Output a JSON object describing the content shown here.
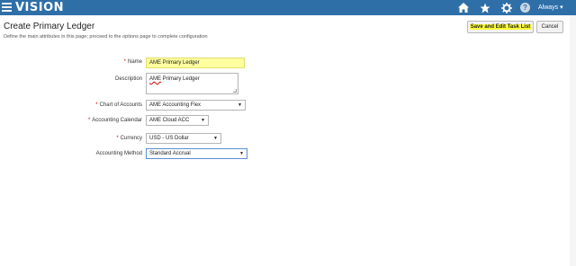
{
  "header": {
    "brand": "VISION",
    "icons": {
      "menu": "hamburger-menu-icon",
      "home": "home-icon",
      "favorites": "star-icon",
      "settings": "gear-icon",
      "help": "help-icon"
    },
    "help_glyph": "?",
    "user_label": "Always ▾",
    "colors": {
      "bar": "#2f6fa8",
      "text": "#ffffff"
    }
  },
  "page": {
    "title": "Create Primary Ledger",
    "description": "Define the main attributes in this page; proceed to the options page to complete configuration"
  },
  "buttons": {
    "save_edit": "Save and Edit Task List",
    "cancel": "Cancel"
  },
  "form": {
    "name": {
      "label": "Name",
      "required": true,
      "value": "AME Primary Ledger"
    },
    "description": {
      "label": "Description",
      "required": false,
      "value_prefix": "AME",
      "value_rest": " Primary Ledger"
    },
    "chart_of_accounts": {
      "label": "Chart of Accounts",
      "required": true,
      "value": "AME Accounting Flex"
    },
    "accounting_calendar": {
      "label": "Accounting Calendar",
      "required": true,
      "value": "AME Cloud ACC"
    },
    "currency": {
      "label": "Currency",
      "required": true,
      "value": "USD - US Dollar"
    },
    "accounting_method": {
      "label": "Accounting Method",
      "required": false,
      "value": "Standard Accrual"
    }
  },
  "required_marker": "*",
  "dropdown_arrow": "▼",
  "highlight_color": "#ffff33"
}
